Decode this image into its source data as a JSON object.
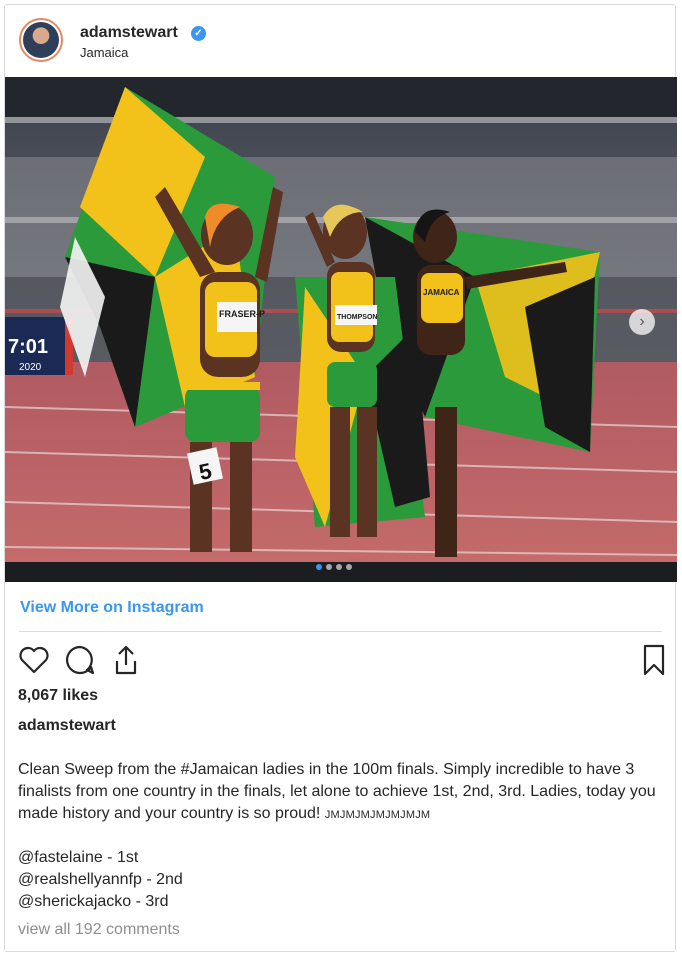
{
  "post": {
    "username": "adamstewart",
    "verified_badge": "verified-icon",
    "location": "Jamaica",
    "view_more": "View More on Instagram",
    "likes": "8,067 likes",
    "caption_user": "adamstewart",
    "caption_text": "Clean Sweep from the #Jamaican ladies in the 100m finals. Simply incredible to have 3 finalists from one country in the finals, let alone to achieve 1st, 2nd, 3rd. Ladies, today you made history and your country is so proud! ",
    "caption_suffix": "JMJMJMJMJMJMJM",
    "mentions": [
      {
        "handle": "@fastelaine",
        "rank": " - 1st"
      },
      {
        "handle": "@realshellyannfp",
        "rank": " - 2nd"
      },
      {
        "handle": "@sherickajacko",
        "rank": " - 3rd"
      }
    ],
    "comments_link": "view all 192 comments"
  },
  "photo": {
    "scoreboard_time": "7:01",
    "scoreboard_year": "2020",
    "bib_number": "5",
    "bib_names": [
      "JAMAICA",
      "FRASER-P",
      "THOMPSON",
      "JAMAICA"
    ],
    "carousel_dots": 4,
    "carousel_active": 0
  },
  "icons": [
    "heart-icon",
    "comment-icon",
    "share-icon",
    "bookmark-icon",
    "chevron-right-icon"
  ],
  "colors": {
    "link_blue": "#3897f0",
    "jamaica_green": "#2a9a3b",
    "jamaica_gold": "#f2c21b",
    "track": "#b35a5f"
  }
}
